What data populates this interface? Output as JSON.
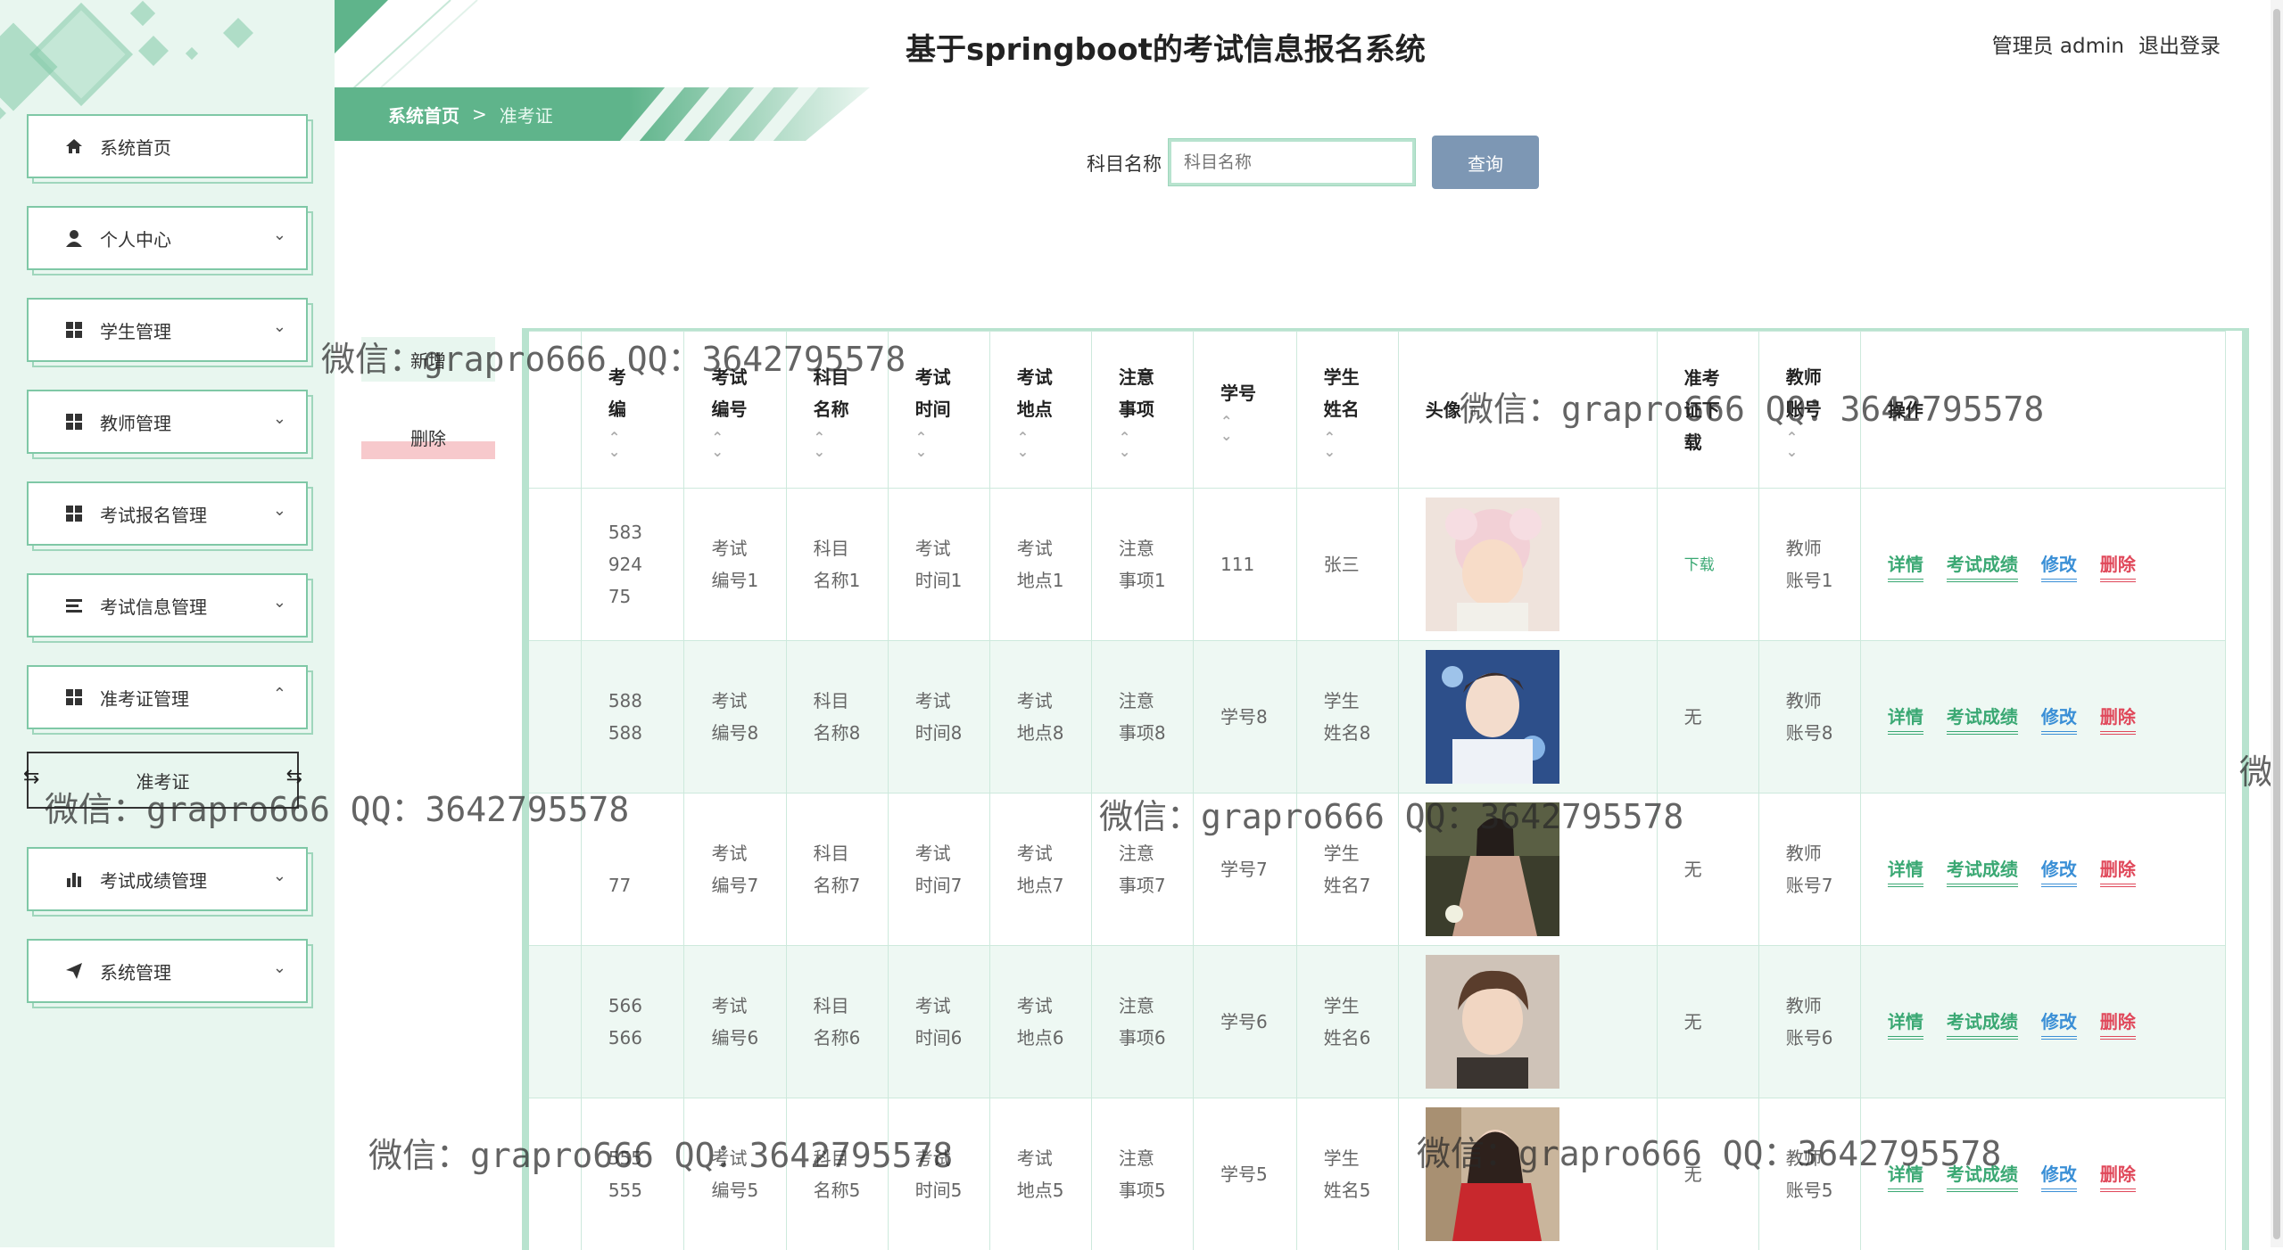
{
  "header": {
    "title": "基于springboot的考试信息报名系统",
    "user_text": "管理员 admin",
    "logout": "退出登录"
  },
  "breadcrumb": {
    "home": "系统首页",
    "sep": ">",
    "current": "准考证"
  },
  "sidebar": {
    "items": [
      {
        "label": "系统首页",
        "icon": "home-icon",
        "arrow": ""
      },
      {
        "label": "个人中心",
        "icon": "person-icon",
        "arrow": "⌄"
      },
      {
        "label": "学生管理",
        "icon": "grid-icon",
        "arrow": "⌄"
      },
      {
        "label": "教师管理",
        "icon": "grid-icon",
        "arrow": "⌄"
      },
      {
        "label": "考试报名管理",
        "icon": "grid-icon",
        "arrow": "⌄"
      },
      {
        "label": "考试信息管理",
        "icon": "list-icon",
        "arrow": "⌄"
      },
      {
        "label": "准考证管理",
        "icon": "grid-icon",
        "arrow": "⌃"
      },
      {
        "label": "考试成绩管理",
        "icon": "bar-chart-icon",
        "arrow": "⌄"
      },
      {
        "label": "系统管理",
        "icon": "send-icon",
        "arrow": "⌄"
      }
    ],
    "submenu": {
      "label": "准考证"
    }
  },
  "search": {
    "label": "科目名称",
    "placeholder": "科目名称",
    "button": "查询"
  },
  "actions": {
    "add": "新增",
    "delete": "删除"
  },
  "table": {
    "columns": [
      {
        "l1": "考",
        "l2": "编"
      },
      {
        "l1": "考试",
        "l2": "编号"
      },
      {
        "l1": "科目",
        "l2": "名称"
      },
      {
        "l1": "考试",
        "l2": "时间"
      },
      {
        "l1": "考试",
        "l2": "地点"
      },
      {
        "l1": "注意",
        "l2": "事项"
      },
      {
        "l1": "学号",
        "l2": ""
      },
      {
        "l1": "学生",
        "l2": "姓名"
      },
      {
        "l1": "头像",
        "l2": ""
      },
      {
        "l1": "准考",
        "l2": "证下",
        "l3": "载"
      },
      {
        "l1": "教师",
        "l2": "账号"
      },
      {
        "l1": "操作",
        "l2": ""
      }
    ],
    "rows": [
      {
        "c0": [
          "583",
          "924",
          "75"
        ],
        "c1": [
          "考试",
          "编号1"
        ],
        "c2": [
          "科目",
          "名称1"
        ],
        "c3": [
          "考试",
          "时间1"
        ],
        "c4": [
          "考试",
          "地点1"
        ],
        "c5": [
          "注意",
          "事项1"
        ],
        "c6": [
          "111",
          ""
        ],
        "c7": [
          "张三",
          ""
        ],
        "dl": "下载",
        "c10": [
          "教师",
          "账号1"
        ],
        "avatar": "child-photo"
      },
      {
        "c0": [
          "588",
          "588",
          ""
        ],
        "c1": [
          "考试",
          "编号8"
        ],
        "c2": [
          "科目",
          "名称8"
        ],
        "c3": [
          "考试",
          "时间8"
        ],
        "c4": [
          "考试",
          "地点8"
        ],
        "c5": [
          "注意",
          "事项8"
        ],
        "c6": [
          "学号8",
          ""
        ],
        "c7": [
          "学生",
          "姓名8"
        ],
        "dl": "无",
        "c10": [
          "教师",
          "账号8"
        ],
        "avatar": "young-man-photo"
      },
      {
        "c0": [
          "",
          "77",
          ""
        ],
        "c1": [
          "考试",
          "编号7"
        ],
        "c2": [
          "科目",
          "名称7"
        ],
        "c3": [
          "考试",
          "时间7"
        ],
        "c4": [
          "考试",
          "地点7"
        ],
        "c5": [
          "注意",
          "事项7"
        ],
        "c6": [
          "学号7",
          ""
        ],
        "c7": [
          "学生",
          "姓名7"
        ],
        "dl": "无",
        "c10": [
          "教师",
          "账号7"
        ],
        "avatar": "woman-outdoor-photo"
      },
      {
        "c0": [
          "566",
          "566",
          ""
        ],
        "c1": [
          "考试",
          "编号6"
        ],
        "c2": [
          "科目",
          "名称6"
        ],
        "c3": [
          "考试",
          "时间6"
        ],
        "c4": [
          "考试",
          "地点6"
        ],
        "c5": [
          "注意",
          "事项6"
        ],
        "c6": [
          "学号6",
          ""
        ],
        "c7": [
          "学生",
          "姓名6"
        ],
        "dl": "无",
        "c10": [
          "教师",
          "账号6"
        ],
        "avatar": "man-portrait-photo"
      },
      {
        "c0": [
          "555",
          "555",
          ""
        ],
        "c1": [
          "考试",
          "编号5"
        ],
        "c2": [
          "科目",
          "名称5"
        ],
        "c3": [
          "考试",
          "时间5"
        ],
        "c4": [
          "考试",
          "地点5"
        ],
        "c5": [
          "注意",
          "事项5"
        ],
        "c6": [
          "学号5",
          ""
        ],
        "c7": [
          "学生",
          "姓名5"
        ],
        "dl": "无",
        "c10": [
          "教师",
          "账号5"
        ],
        "avatar": "woman-red-photo"
      }
    ],
    "ops": {
      "detail": "详情",
      "score": "考试成绩",
      "edit": "修改",
      "remove": "删除"
    }
  },
  "watermark": "微信：grapro666 QQ：3642795578",
  "watermark_edge": "微",
  "colors": {
    "accent": "#5fb48b",
    "sidebar_bg": "#e8f6ef",
    "search_btn": "#7d97b4",
    "delete": "#e0485a",
    "edit": "#3a8fd6"
  }
}
